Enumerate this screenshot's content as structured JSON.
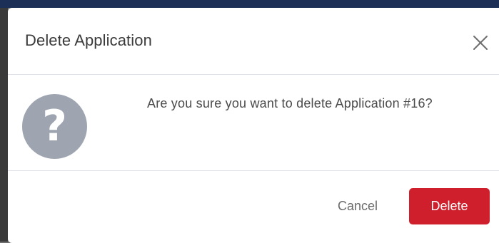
{
  "modal": {
    "title": "Delete Application",
    "close_icon": "close-icon",
    "body": {
      "icon": "question-icon",
      "icon_glyph": "?",
      "message": "Are you sure you want to delete Application #16?"
    },
    "footer": {
      "cancel_label": "Cancel",
      "delete_label": "Delete"
    }
  },
  "colors": {
    "delete_button": "#cf1f2c",
    "question_icon_bg": "#9ea5b1",
    "backdrop": "#6f7073",
    "top_bar": "#1c2f57"
  }
}
